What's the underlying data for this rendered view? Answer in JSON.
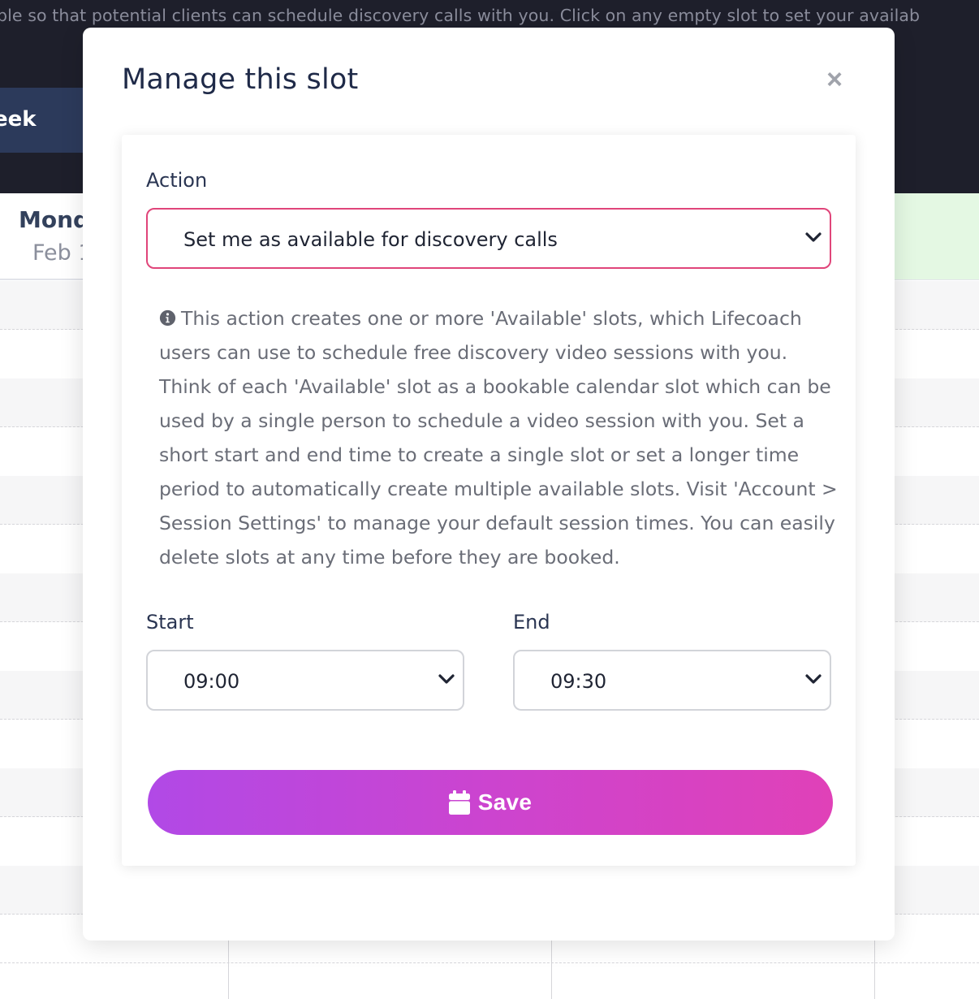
{
  "background": {
    "intro_text": "ble so that potential clients can schedule discovery calls with you. Click on any empty slot to set your availab",
    "week_button_label": "eek",
    "day_name": "Mond",
    "day_date": "Feb 1"
  },
  "modal": {
    "title": "Manage this slot",
    "close_label": "×",
    "action": {
      "label": "Action",
      "selected": "Set me as available for discovery calls"
    },
    "info_text": "This action creates one or more 'Available' slots, which Lifecoach users can use to schedule free discovery video sessions with you. Think of each 'Available' slot as a bookable calendar slot which can be used by a single person to schedule a video session with you. Set a short start and end time to create a single slot or set a longer time period to automatically create multiple available slots. Visit 'Account > Session Settings' to manage your default session times. You can easily delete slots at any time before they are booked.",
    "start": {
      "label": "Start",
      "selected": "09:00"
    },
    "end": {
      "label": "End",
      "selected": "09:30"
    },
    "save_label": "Save"
  },
  "icons": {
    "close": "close-icon",
    "info": "info-icon",
    "chevron": "chevron-down-icon",
    "save": "calendar-icon"
  },
  "colors": {
    "header_bg": "#1e1f2b",
    "active_border": "#e0457a",
    "save_gradient_start": "#b149e6",
    "save_gradient_end": "#e041b8",
    "title_text": "#1f2a48"
  }
}
